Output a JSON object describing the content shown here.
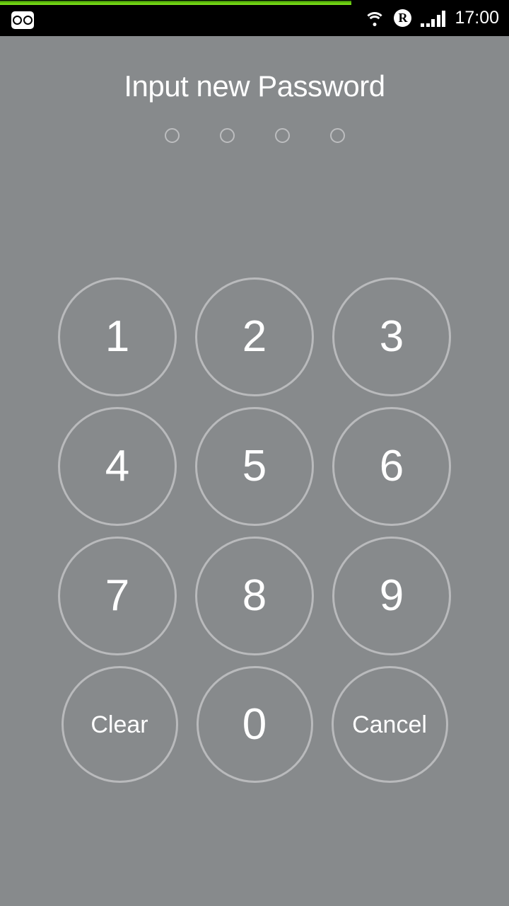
{
  "status_bar": {
    "time": "17:00",
    "left_icons": [
      {
        "name": "voicemail-icon",
        "label": "Voicemail"
      }
    ],
    "right_icons": [
      {
        "name": "wifi-icon",
        "label": "Wi-Fi"
      },
      {
        "name": "roaming-icon",
        "label": "R"
      },
      {
        "name": "signal-icon",
        "label": "Mobile signal"
      }
    ],
    "background_color": "#000000",
    "foreground_color": "#ffffff"
  },
  "progress": {
    "name": "top-progress-bar",
    "percent": 69,
    "color": "#63c60d"
  },
  "screen": {
    "background_color": "#878a8c",
    "title": "Input new Password"
  },
  "pin_indicator": {
    "length": 4,
    "entered": 0,
    "dots": [
      {
        "filled": false
      },
      {
        "filled": false
      },
      {
        "filled": false
      },
      {
        "filled": false
      }
    ],
    "outline_color": "#bcbdbf"
  },
  "keypad": {
    "outline_color": "#b9babc",
    "label_color": "#ffffff",
    "rows": [
      [
        {
          "name": "key-1",
          "label": "1",
          "kind": "digit"
        },
        {
          "name": "key-2",
          "label": "2",
          "kind": "digit"
        },
        {
          "name": "key-3",
          "label": "3",
          "kind": "digit"
        }
      ],
      [
        {
          "name": "key-4",
          "label": "4",
          "kind": "digit"
        },
        {
          "name": "key-5",
          "label": "5",
          "kind": "digit"
        },
        {
          "name": "key-6",
          "label": "6",
          "kind": "digit"
        }
      ],
      [
        {
          "name": "key-7",
          "label": "7",
          "kind": "digit"
        },
        {
          "name": "key-8",
          "label": "8",
          "kind": "digit"
        },
        {
          "name": "key-9",
          "label": "9",
          "kind": "digit"
        }
      ],
      [
        {
          "name": "key-clear",
          "label": "Clear",
          "kind": "word"
        },
        {
          "name": "key-0",
          "label": "0",
          "kind": "digit"
        },
        {
          "name": "key-cancel",
          "label": "Cancel",
          "kind": "word"
        }
      ]
    ]
  }
}
